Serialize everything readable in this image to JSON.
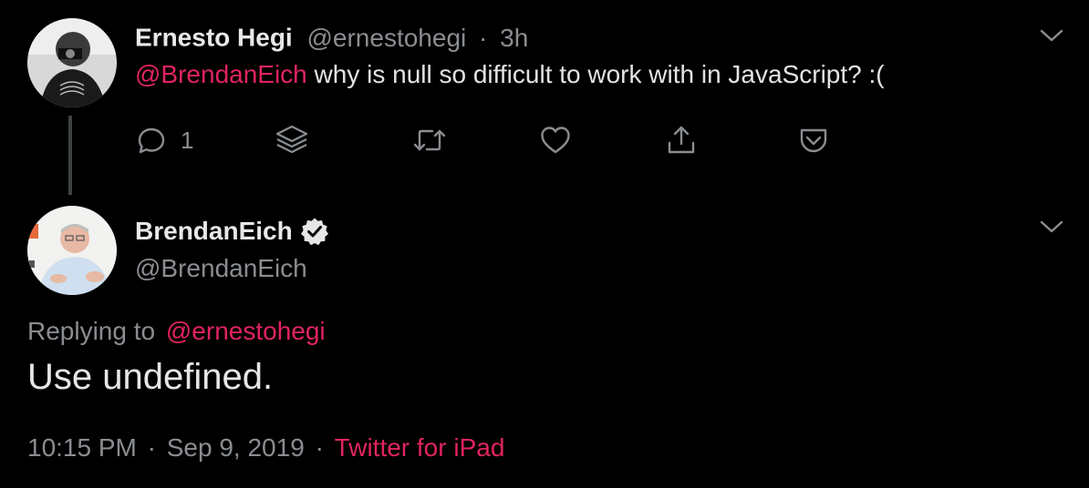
{
  "tweet1": {
    "display_name": "Ernesto Hegi",
    "handle": "@ernestohegi",
    "separator": "·",
    "time": "3h",
    "mention": "@BrendanEich",
    "text": " why is null so difficult to work with in JavaScript? :(",
    "reply_count": "1",
    "icons": [
      "reply-icon",
      "layers-icon",
      "retweet-icon",
      "like-icon",
      "share-icon",
      "pocket-icon",
      "chevron-down-icon"
    ]
  },
  "tweet2": {
    "display_name": "BrendanEich",
    "verified": true,
    "handle": "@BrendanEich",
    "replying_label": "Replying to",
    "replying_to": "@ernestohegi",
    "text": "Use undefined.",
    "time": "10:15 PM",
    "date": "Sep 9, 2019",
    "separator": "·",
    "source": "Twitter for iPad"
  },
  "colors": {
    "background": "#000000",
    "accent": "#e0245e",
    "muted": "#8a8d91",
    "text": "#e3e3e3"
  }
}
